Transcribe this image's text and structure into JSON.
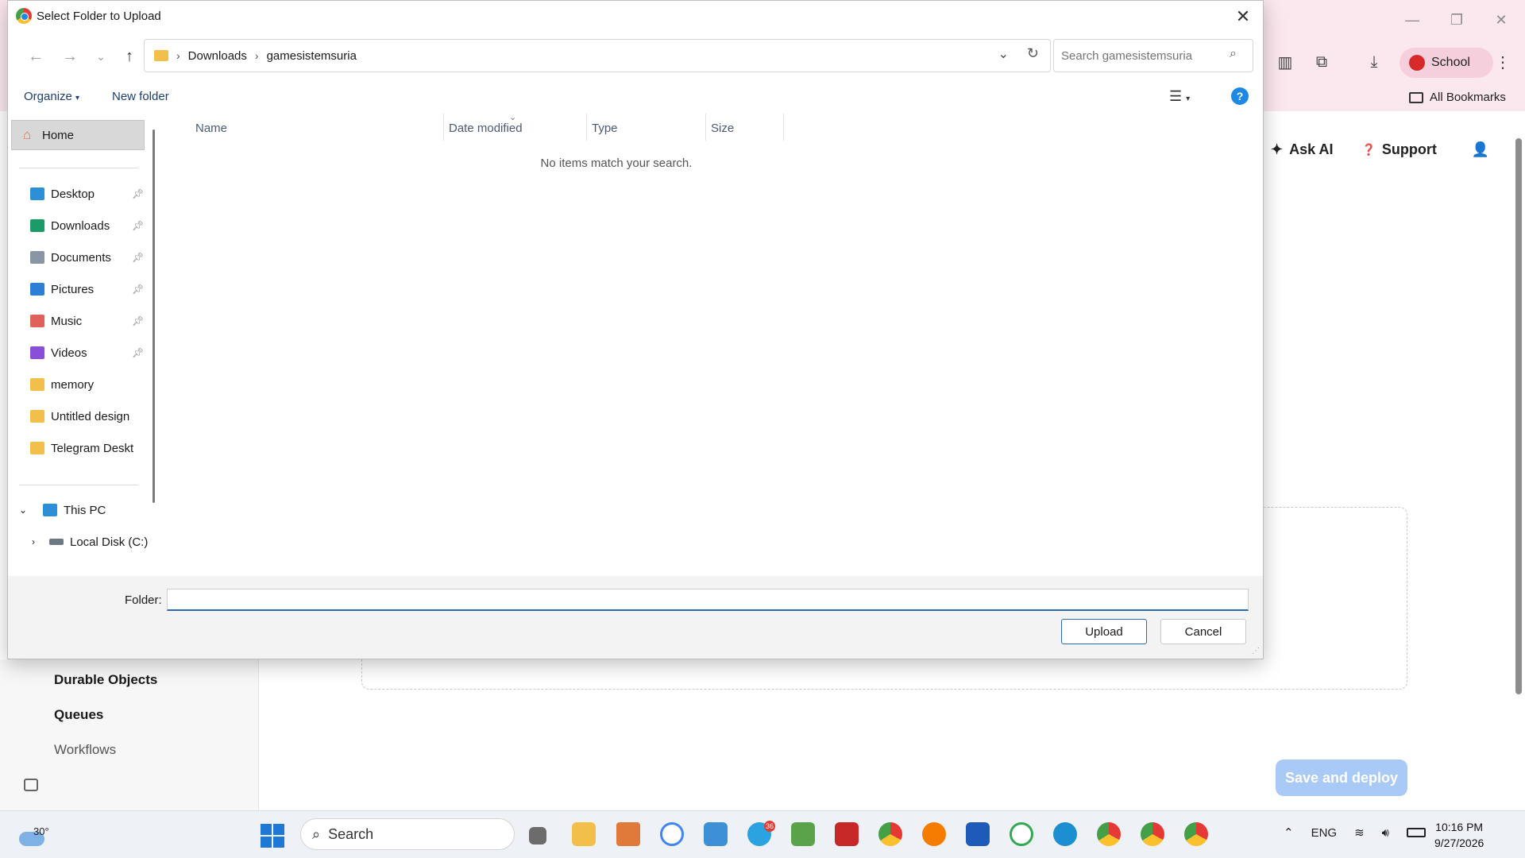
{
  "browser": {
    "profile_name": "School",
    "bookmarks_label": "All Bookmarks",
    "header": {
      "ask_ai": "Ask AI",
      "support": "Support"
    },
    "sidebar_items": [
      "Durable Objects",
      "Queues",
      "Workflows"
    ],
    "save_deploy_label": "Save and deploy"
  },
  "dialog": {
    "title": "Select Folder to Upload",
    "breadcrumb": [
      "Downloads",
      "gamesistemsuria"
    ],
    "search_placeholder": "Search gamesistemsuria",
    "organize_label": "Organize",
    "new_folder_label": "New folder",
    "help_label": "?",
    "sidebar": {
      "home": "Home",
      "quick_access": [
        {
          "label": "Desktop",
          "icon": "desktop-icon",
          "color": "#2d8fd5",
          "pinned": true
        },
        {
          "label": "Downloads",
          "icon": "download-icon",
          "color": "#1c9a6a",
          "pinned": true
        },
        {
          "label": "Documents",
          "icon": "document-icon",
          "color": "#8a95a5",
          "pinned": true
        },
        {
          "label": "Pictures",
          "icon": "pictures-icon",
          "color": "#2d7fd5",
          "pinned": true
        },
        {
          "label": "Music",
          "icon": "music-icon",
          "color": "#e0605a",
          "pinned": true
        },
        {
          "label": "Videos",
          "icon": "videos-icon",
          "color": "#8a4fd8",
          "pinned": true
        },
        {
          "label": "memory",
          "icon": "folder-icon",
          "color": "#f2c04a",
          "pinned": false
        },
        {
          "label": "Untitled design",
          "icon": "folder-icon",
          "color": "#f2c04a",
          "pinned": false
        },
        {
          "label": "Telegram Deskt",
          "icon": "folder-icon",
          "color": "#f2c04a",
          "pinned": false
        }
      ],
      "this_pc": "This PC",
      "local_disk": "Local Disk (C:)"
    },
    "columns": [
      "Name",
      "Date modified",
      "Type",
      "Size"
    ],
    "empty_message": "No items match your search.",
    "folder_label": "Folder:",
    "folder_value": "",
    "upload_label": "Upload",
    "cancel_label": "Cancel"
  },
  "taskbar": {
    "weather_temp": "30°",
    "search_label": "Search",
    "telegram_badge": "36",
    "language": "ENG",
    "time": "10:16 PM",
    "date": "9/27/2026"
  },
  "colors": {
    "accent": "#2d6ab0",
    "browser_chrome": "#fbe7ee",
    "deploy_button": "#a9c9f6"
  }
}
